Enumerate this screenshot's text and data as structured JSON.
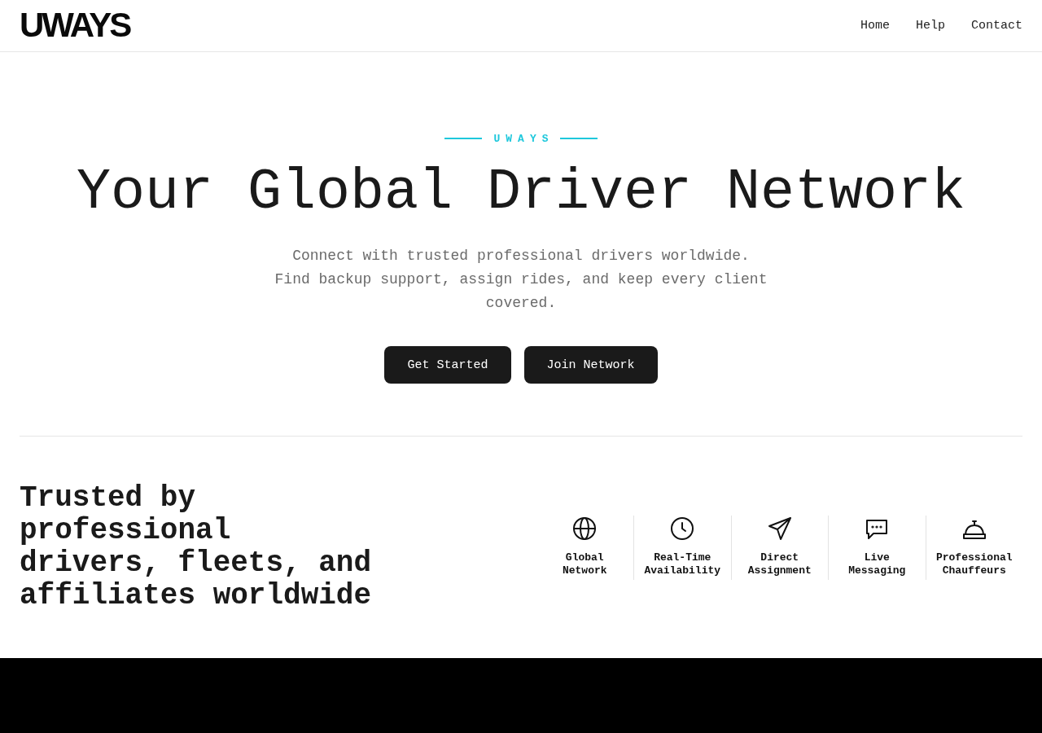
{
  "header": {
    "logo": "UWAYS",
    "nav": [
      "Home",
      "Help",
      "Contact"
    ]
  },
  "hero": {
    "eyebrow": "UWAYS",
    "title": "Your Global Driver Network",
    "subtitle": "Connect with trusted professional drivers worldwide. Find backup support, assign rides, and keep every client covered.",
    "buttons": [
      "Get Started",
      "Join Network"
    ]
  },
  "trust": {
    "heading": "Trusted by professional drivers, fleets, and affiliates worldwide",
    "features": [
      {
        "label": "Global Network"
      },
      {
        "label": "Real-Time Availability"
      },
      {
        "label": "Direct Assignment"
      },
      {
        "label": "Live Messaging"
      },
      {
        "label": "Professional Chauffeurs"
      }
    ]
  }
}
